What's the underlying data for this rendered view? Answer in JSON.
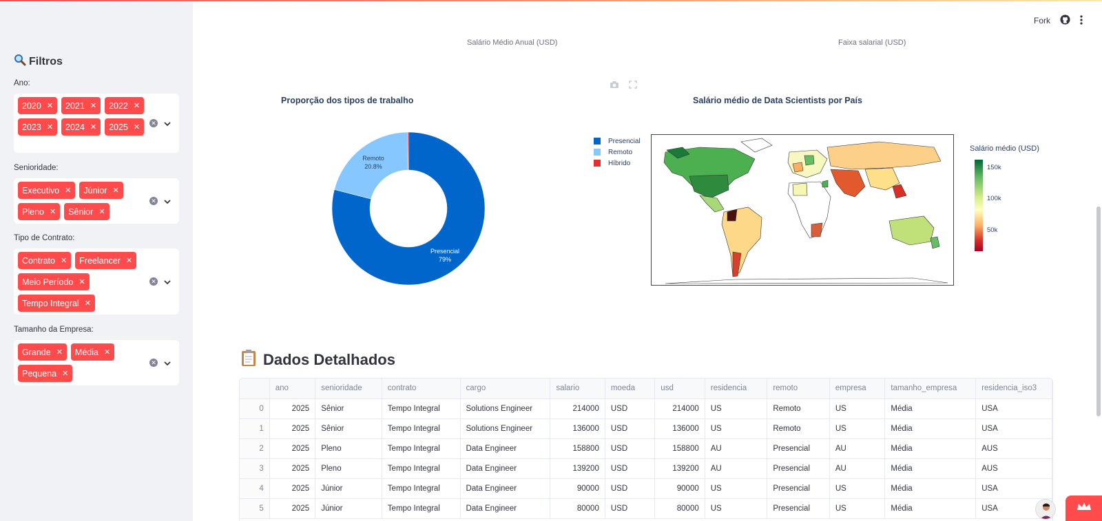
{
  "sidebar": {
    "title": "Filtros",
    "filters": [
      {
        "label": "Ano:",
        "tags": [
          "2020",
          "2021",
          "2022",
          "2023",
          "2024",
          "2025"
        ]
      },
      {
        "label": "Senioridade:",
        "tags": [
          "Executivo",
          "Júnior",
          "Pleno",
          "Sênior"
        ]
      },
      {
        "label": "Tipo de Contrato:",
        "tags": [
          "Contrato",
          "Freelancer",
          "Meio Período",
          "Tempo Integral"
        ]
      },
      {
        "label": "Tamanho da Empresa:",
        "tags": [
          "Grande",
          "Média",
          "Pequena"
        ]
      }
    ]
  },
  "header": {
    "fork_label": "Fork"
  },
  "subtitles": {
    "left": "Salário Médio Anual (USD)",
    "right": "Faixa salarial (USD)"
  },
  "donut": {
    "title": "Proporção dos tipos de trabalho",
    "remoto_label": "Remoto",
    "remoto_pct": "20.8%",
    "presencial_label": "Presencial",
    "presencial_pct": "79%"
  },
  "map": {
    "title": "Salário médio de Data Scientists por País",
    "colorbar_title": "Salário médio (USD)",
    "ticks": [
      "150k",
      "100k",
      "50k"
    ]
  },
  "legend": [
    "Presencial",
    "Remoto",
    "Híbrido"
  ],
  "colors": {
    "presencial": "#0066cc",
    "remoto": "#87c7ff",
    "hibrido": "#e62e2e",
    "accent": "#ff4b4b"
  },
  "chart_data": {
    "type": "pie",
    "title": "Proporção dos tipos de trabalho",
    "categories": [
      "Presencial",
      "Remoto",
      "Híbrido"
    ],
    "values": [
      79.0,
      20.8,
      0.2
    ],
    "hole": true,
    "legend_position": "right"
  },
  "section": {
    "title": "Dados Detalhados"
  },
  "table": {
    "columns": [
      "",
      "ano",
      "senioridade",
      "contrato",
      "cargo",
      "salario",
      "moeda",
      "usd",
      "residencia",
      "remoto",
      "empresa",
      "tamanho_empresa",
      "residencia_iso3"
    ],
    "rows": [
      [
        "0",
        "2025",
        "Sênior",
        "Tempo Integral",
        "Solutions Engineer",
        "214000",
        "USD",
        "214000",
        "US",
        "Remoto",
        "US",
        "Média",
        "USA"
      ],
      [
        "1",
        "2025",
        "Sênior",
        "Tempo Integral",
        "Solutions Engineer",
        "136000",
        "USD",
        "136000",
        "US",
        "Remoto",
        "US",
        "Média",
        "USA"
      ],
      [
        "2",
        "2025",
        "Pleno",
        "Tempo Integral",
        "Data Engineer",
        "158800",
        "USD",
        "158800",
        "AU",
        "Presencial",
        "AU",
        "Média",
        "AUS"
      ],
      [
        "3",
        "2025",
        "Pleno",
        "Tempo Integral",
        "Data Engineer",
        "139200",
        "USD",
        "139200",
        "AU",
        "Presencial",
        "AU",
        "Média",
        "AUS"
      ],
      [
        "4",
        "2025",
        "Júnior",
        "Tempo Integral",
        "Data Engineer",
        "90000",
        "USD",
        "90000",
        "US",
        "Presencial",
        "US",
        "Média",
        "USA"
      ],
      [
        "5",
        "2025",
        "Júnior",
        "Tempo Integral",
        "Data Engineer",
        "80000",
        "USD",
        "80000",
        "US",
        "Presencial",
        "US",
        "Média",
        "USA"
      ]
    ]
  }
}
